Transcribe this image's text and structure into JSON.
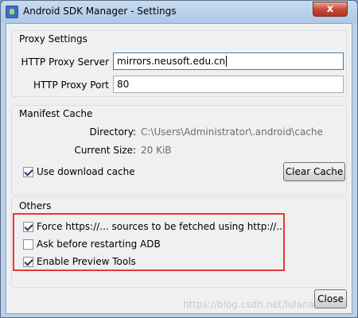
{
  "window": {
    "title": "Android SDK Manager - Settings",
    "close_glyph": "x"
  },
  "proxy": {
    "group_title": "Proxy Settings",
    "server_label": "HTTP Proxy Server",
    "server_value": "mirrors.neusoft.edu.cn",
    "port_label": "HTTP Proxy Port",
    "port_value": "80"
  },
  "manifest": {
    "group_title": "Manifest Cache",
    "directory_label": "Directory:",
    "directory_value": "C:\\Users\\Administrator\\.android\\cache",
    "size_label": "Current Size:",
    "size_value": "20 KiB",
    "use_cache_label": "Use download cache",
    "use_cache_checked": true,
    "clear_cache_button": "Clear Cache"
  },
  "others": {
    "group_title": "Others",
    "options": [
      {
        "label": "Force https://... sources to be fetched using http://...",
        "checked": true
      },
      {
        "label": "Ask before restarting ADB",
        "checked": false
      },
      {
        "label": "Enable Preview Tools",
        "checked": true
      }
    ]
  },
  "footer": {
    "close_button": "Close"
  },
  "watermark": "https://blog.csdn.net/lulanao",
  "colors": {
    "highlight": "#e53935",
    "title_bar": "#b9d1ea",
    "dialog_bg": "#f0f0f0"
  }
}
